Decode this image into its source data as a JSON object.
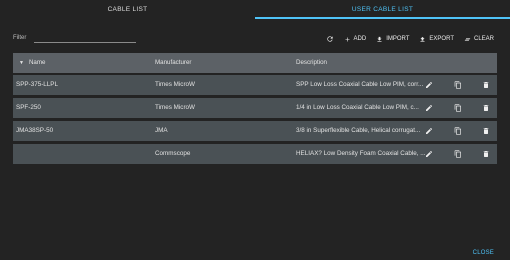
{
  "tabs": [
    {
      "label": "CABLE LIST"
    },
    {
      "label": "USER CABLE LIST"
    }
  ],
  "filter": {
    "label": "Filter",
    "value": ""
  },
  "toolbar": {
    "add_label": "ADD",
    "import_label": "IMPORT",
    "export_label": "EXPORT",
    "clear_label": "CLEAR"
  },
  "table": {
    "columns": [
      "Name",
      "Manufacturer",
      "Description"
    ],
    "rows": [
      {
        "name": "SPP-375-LLPL",
        "manufacturer": "Times MicroW",
        "description": "SPP Low Loss Coaxial Cable Low PIM, corr..."
      },
      {
        "name": "SPF-250",
        "manufacturer": "Times MicroW",
        "description": "1/4  in Low Loss Coaxial Cable Low PIM, c..."
      },
      {
        "name": "JMA38SP-50",
        "manufacturer": "JMA",
        "description": "3/8 in Superflexible Cable, Helical corrugat..."
      },
      {
        "name": "",
        "manufacturer": "Commscope",
        "description": "HELIAX? Low Density Foam Coaxial Cable, ..."
      }
    ]
  },
  "footer": {
    "close_label": "CLOSE"
  },
  "colors": {
    "accent": "#4fc3f7",
    "background": "#232323",
    "header_bg": "#5c6166",
    "row_bg": "#4a5155"
  }
}
